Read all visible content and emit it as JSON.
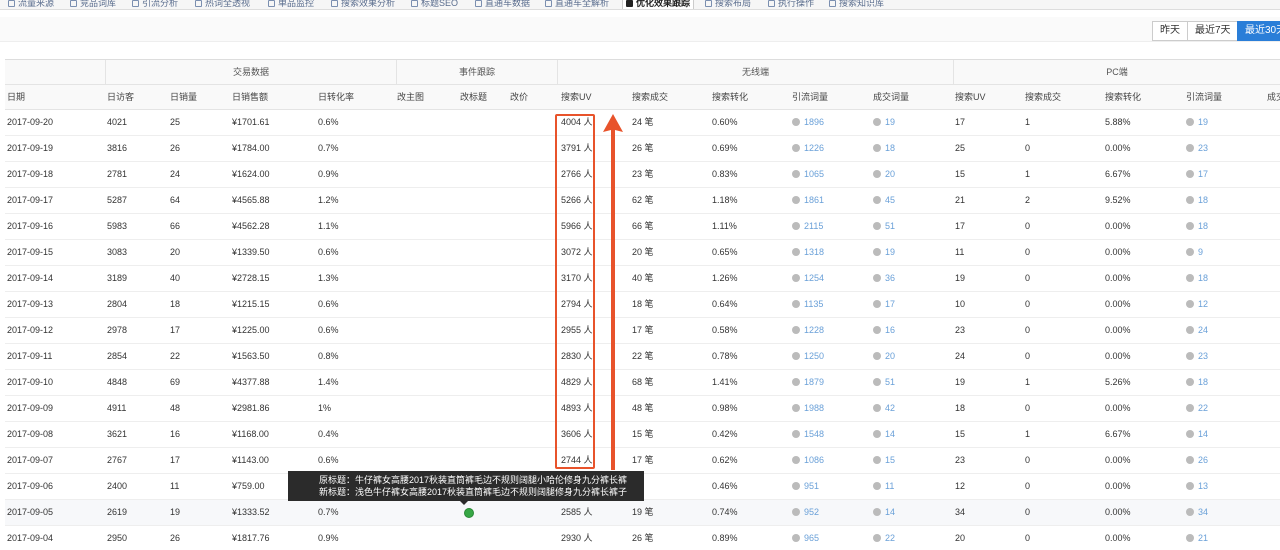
{
  "tabs": [
    {
      "label": "流量来源",
      "icon": "chart-icon"
    },
    {
      "label": "竞品词库",
      "icon": "chart-icon"
    },
    {
      "label": "引流分析",
      "icon": "chart-icon"
    },
    {
      "label": "热词全透视",
      "icon": "chart-icon"
    },
    {
      "label": "单品监控",
      "icon": "chart-icon"
    },
    {
      "label": "搜索效果分析",
      "icon": "chart-icon"
    },
    {
      "label": "标题SEO",
      "icon": "chart-icon"
    },
    {
      "label": "直通车数据",
      "icon": "chart-icon"
    },
    {
      "label": "直通车全解析",
      "icon": "chart-icon"
    },
    {
      "label": "优化效果跟踪",
      "icon": "bookmark-icon",
      "active": true
    },
    {
      "label": "搜索布局",
      "icon": "chart-icon"
    },
    {
      "label": "执行操作",
      "icon": "chart-icon"
    },
    {
      "label": "搜索知识库",
      "icon": "chart-icon"
    }
  ],
  "range_buttons": [
    "昨天",
    "最近7天",
    "最近30天"
  ],
  "groups": [
    "交易数据",
    "事件跟踪",
    "无线端",
    "PC端"
  ],
  "columns": [
    "日期",
    "日访客",
    "日销量",
    "日销售额",
    "日转化率",
    "改主图",
    "改标题",
    "改价",
    "搜索UV",
    "搜索成交",
    "搜索转化",
    "引流词量",
    "成交词量",
    "搜索UV",
    "搜索成交",
    "搜索转化",
    "引流词量",
    "成交"
  ],
  "rows": [
    {
      "date": "2017-09-20",
      "visitors": "4021",
      "sales": "25",
      "revenue": "¥1701.61",
      "conv": "0.6%",
      "title_event": "",
      "m_uv": "4004 人",
      "m_deals": "24 笔",
      "m_conv": "0.60%",
      "m_words": "1896",
      "m_deal_words": "19",
      "pc_uv": "17",
      "pc_deals": "1",
      "pc_conv": "5.88%",
      "pc_words": "19"
    },
    {
      "date": "2017-09-19",
      "visitors": "3816",
      "sales": "26",
      "revenue": "¥1784.00",
      "conv": "0.7%",
      "title_event": "",
      "m_uv": "3791 人",
      "m_deals": "26 笔",
      "m_conv": "0.69%",
      "m_words": "1226",
      "m_deal_words": "18",
      "pc_uv": "25",
      "pc_deals": "0",
      "pc_conv": "0.00%",
      "pc_words": "23"
    },
    {
      "date": "2017-09-18",
      "visitors": "2781",
      "sales": "24",
      "revenue": "¥1624.00",
      "conv": "0.9%",
      "title_event": "",
      "m_uv": "2766 人",
      "m_deals": "23 笔",
      "m_conv": "0.83%",
      "m_words": "1065",
      "m_deal_words": "20",
      "pc_uv": "15",
      "pc_deals": "1",
      "pc_conv": "6.67%",
      "pc_words": "17"
    },
    {
      "date": "2017-09-17",
      "visitors": "5287",
      "sales": "64",
      "revenue": "¥4565.88",
      "conv": "1.2%",
      "title_event": "",
      "m_uv": "5266 人",
      "m_deals": "62 笔",
      "m_conv": "1.18%",
      "m_words": "1861",
      "m_deal_words": "45",
      "pc_uv": "21",
      "pc_deals": "2",
      "pc_conv": "9.52%",
      "pc_words": "18"
    },
    {
      "date": "2017-09-16",
      "visitors": "5983",
      "sales": "66",
      "revenue": "¥4562.28",
      "conv": "1.1%",
      "title_event": "",
      "m_uv": "5966 人",
      "m_deals": "66 笔",
      "m_conv": "1.11%",
      "m_words": "2115",
      "m_deal_words": "51",
      "pc_uv": "17",
      "pc_deals": "0",
      "pc_conv": "0.00%",
      "pc_words": "18"
    },
    {
      "date": "2017-09-15",
      "visitors": "3083",
      "sales": "20",
      "revenue": "¥1339.50",
      "conv": "0.6%",
      "title_event": "",
      "m_uv": "3072 人",
      "m_deals": "20 笔",
      "m_conv": "0.65%",
      "m_words": "1318",
      "m_deal_words": "19",
      "pc_uv": "11",
      "pc_deals": "0",
      "pc_conv": "0.00%",
      "pc_words": "9"
    },
    {
      "date": "2017-09-14",
      "visitors": "3189",
      "sales": "40",
      "revenue": "¥2728.15",
      "conv": "1.3%",
      "title_event": "",
      "m_uv": "3170 人",
      "m_deals": "40 笔",
      "m_conv": "1.26%",
      "m_words": "1254",
      "m_deal_words": "36",
      "pc_uv": "19",
      "pc_deals": "0",
      "pc_conv": "0.00%",
      "pc_words": "18"
    },
    {
      "date": "2017-09-13",
      "visitors": "2804",
      "sales": "18",
      "revenue": "¥1215.15",
      "conv": "0.6%",
      "title_event": "",
      "m_uv": "2794 人",
      "m_deals": "18 笔",
      "m_conv": "0.64%",
      "m_words": "1135",
      "m_deal_words": "17",
      "pc_uv": "10",
      "pc_deals": "0",
      "pc_conv": "0.00%",
      "pc_words": "12"
    },
    {
      "date": "2017-09-12",
      "visitors": "2978",
      "sales": "17",
      "revenue": "¥1225.00",
      "conv": "0.6%",
      "title_event": "",
      "m_uv": "2955 人",
      "m_deals": "17 笔",
      "m_conv": "0.58%",
      "m_words": "1228",
      "m_deal_words": "16",
      "pc_uv": "23",
      "pc_deals": "0",
      "pc_conv": "0.00%",
      "pc_words": "24"
    },
    {
      "date": "2017-09-11",
      "visitors": "2854",
      "sales": "22",
      "revenue": "¥1563.50",
      "conv": "0.8%",
      "title_event": "",
      "m_uv": "2830 人",
      "m_deals": "22 笔",
      "m_conv": "0.78%",
      "m_words": "1250",
      "m_deal_words": "20",
      "pc_uv": "24",
      "pc_deals": "0",
      "pc_conv": "0.00%",
      "pc_words": "23"
    },
    {
      "date": "2017-09-10",
      "visitors": "4848",
      "sales": "69",
      "revenue": "¥4377.88",
      "conv": "1.4%",
      "title_event": "",
      "m_uv": "4829 人",
      "m_deals": "68 笔",
      "m_conv": "1.41%",
      "m_words": "1879",
      "m_deal_words": "51",
      "pc_uv": "19",
      "pc_deals": "1",
      "pc_conv": "5.26%",
      "pc_words": "18"
    },
    {
      "date": "2017-09-09",
      "visitors": "4911",
      "sales": "48",
      "revenue": "¥2981.86",
      "conv": "1%",
      "title_event": "",
      "m_uv": "4893 人",
      "m_deals": "48 笔",
      "m_conv": "0.98%",
      "m_words": "1988",
      "m_deal_words": "42",
      "pc_uv": "18",
      "pc_deals": "0",
      "pc_conv": "0.00%",
      "pc_words": "22"
    },
    {
      "date": "2017-09-08",
      "visitors": "3621",
      "sales": "16",
      "revenue": "¥1168.00",
      "conv": "0.4%",
      "title_event": "",
      "m_uv": "3606 人",
      "m_deals": "15 笔",
      "m_conv": "0.42%",
      "m_words": "1548",
      "m_deal_words": "14",
      "pc_uv": "15",
      "pc_deals": "1",
      "pc_conv": "6.67%",
      "pc_words": "14"
    },
    {
      "date": "2017-09-07",
      "visitors": "2767",
      "sales": "17",
      "revenue": "¥1143.00",
      "conv": "0.6%",
      "title_event": "",
      "m_uv": "2744 人",
      "m_deals": "17 笔",
      "m_conv": "0.62%",
      "m_words": "1086",
      "m_deal_words": "15",
      "pc_uv": "23",
      "pc_deals": "0",
      "pc_conv": "0.00%",
      "pc_words": "26"
    },
    {
      "date": "2017-09-06",
      "visitors": "2400",
      "sales": "11",
      "revenue": "¥759.00",
      "conv": "",
      "title_event": "",
      "m_uv": "",
      "m_deals": "",
      "m_conv": "0.46%",
      "m_words": "951",
      "m_deal_words": "11",
      "pc_uv": "12",
      "pc_deals": "0",
      "pc_conv": "0.00%",
      "pc_words": "13"
    },
    {
      "date": "2017-09-05",
      "visitors": "2619",
      "sales": "19",
      "revenue": "¥1333.52",
      "conv": "0.7%",
      "title_event": "changed",
      "m_uv": "2585 人",
      "m_deals": "19 笔",
      "m_conv": "0.74%",
      "m_words": "952",
      "m_deal_words": "14",
      "pc_uv": "34",
      "pc_deals": "0",
      "pc_conv": "0.00%",
      "pc_words": "34"
    },
    {
      "date": "2017-09-04",
      "visitors": "2950",
      "sales": "26",
      "revenue": "¥1817.76",
      "conv": "0.9%",
      "title_event": "",
      "m_uv": "2930 人",
      "m_deals": "26 笔",
      "m_conv": "0.89%",
      "m_words": "965",
      "m_deal_words": "22",
      "pc_uv": "20",
      "pc_deals": "0",
      "pc_conv": "0.00%",
      "pc_words": "21"
    }
  ],
  "tooltip": {
    "original": "原标题：牛仔裤女高腰2017秋装直筒裤毛边不规则阔腿小哈伦修身九分裤长裤",
    "new": "新标题：浅色牛仔裤女高腰2017秋装直筒裤毛边不规则阔腿修身九分裤长裤子"
  },
  "colors": {
    "accent": "#2a7ed8",
    "highlight": "#e8532b",
    "event_icon": "#37a745"
  }
}
